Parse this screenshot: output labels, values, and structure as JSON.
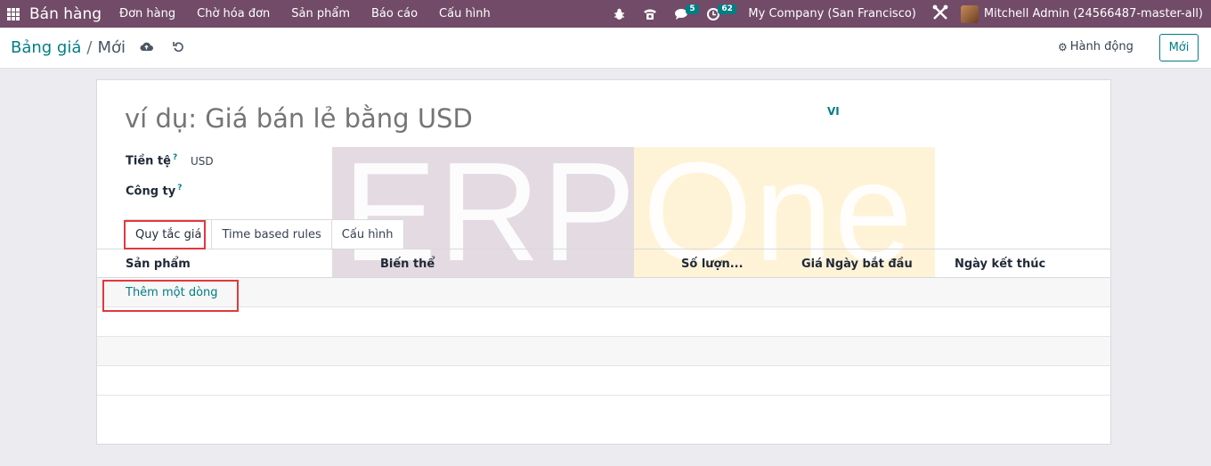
{
  "navbar": {
    "app_name": "Bán hàng",
    "menu": [
      "Đơn hàng",
      "Chờ hóa đơn",
      "Sản phẩm",
      "Báo cáo",
      "Cấu hình"
    ],
    "messages_count": "5",
    "activities_count": "62",
    "company": "My Company (San Francisco)",
    "user": "Mitchell Admin (24566487-master-all)"
  },
  "breadcrumb": {
    "parent": "Bảng giá",
    "current": "Mới"
  },
  "actions": {
    "action_label": "Hành động",
    "new_label": "Mới"
  },
  "form": {
    "name_placeholder": "ví dụ: Giá bán lẻ bằng USD",
    "lang": "VI",
    "currency_label": "Tiền tệ",
    "currency_value": "USD",
    "company_label": "Công ty",
    "help_mark": "?"
  },
  "watermark": {
    "left": "ERP",
    "right": "One"
  },
  "tabs": [
    "Quy tắc giá",
    "Time based rules",
    "Cấu hình"
  ],
  "table": {
    "columns": [
      "Sản phẩm",
      "Biến thể",
      "Số lượn...",
      "Giá",
      "Ngày bắt đầu",
      "Ngày kết thúc"
    ],
    "add_line": "Thêm một dòng"
  },
  "colors": {
    "navbar": "#714b67",
    "accent": "#017e84",
    "highlight": "#e0393e"
  }
}
